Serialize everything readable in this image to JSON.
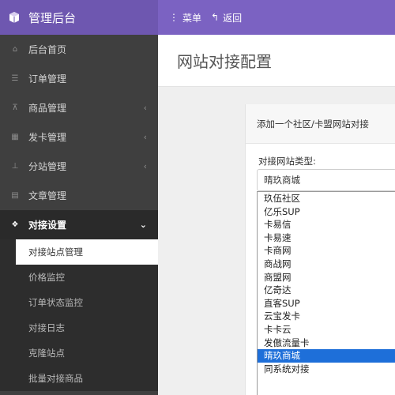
{
  "header": {
    "app_title": "管理后台",
    "menu_label": "菜单",
    "back_label": "返回"
  },
  "sidebar": {
    "items": [
      {
        "label": "后台首页",
        "icon": "home-icon"
      },
      {
        "label": "订单管理",
        "icon": "list-icon"
      },
      {
        "label": "商品管理",
        "icon": "cart-icon",
        "has_arrow": true
      },
      {
        "label": "发卡管理",
        "icon": "grid-icon",
        "has_arrow": true
      },
      {
        "label": "分站管理",
        "icon": "sitemap-icon",
        "has_arrow": true
      },
      {
        "label": "文章管理",
        "icon": "document-icon"
      },
      {
        "label": "对接设置",
        "icon": "cubes-icon",
        "has_arrow": true,
        "active": true
      }
    ],
    "subitems": [
      {
        "label": "对接站点管理",
        "active": true
      },
      {
        "label": "价格监控"
      },
      {
        "label": "订单状态监控"
      },
      {
        "label": "对接日志"
      },
      {
        "label": "克隆站点"
      },
      {
        "label": "批量对接商品"
      }
    ]
  },
  "main": {
    "page_title": "网站对接配置",
    "panel_heading": "添加一个社区/卡盟网站对接",
    "field_label": "对接网站类型:",
    "selected_value": "晴玖商城",
    "options": [
      "玖伍社区",
      "亿乐SUP",
      "卡易信",
      "卡易速",
      "卡商网",
      "商战网",
      "商盟网",
      "亿奇达",
      "直客SUP",
      "云宝发卡",
      "卡卡云",
      "发傲流量卡",
      "晴玖商城",
      "同系统对接"
    ],
    "selected_index": 12
  },
  "colors": {
    "brand_bg": "#6e57b0",
    "topbar_bg": "#7b62c2",
    "sidebar_bg": "#3f3f3f",
    "selected_option": "#1e6fd9"
  }
}
